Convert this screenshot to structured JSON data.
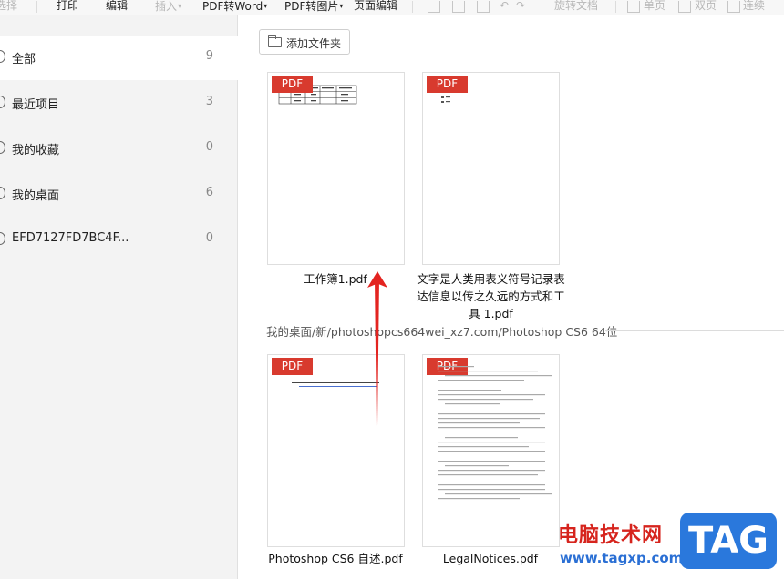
{
  "toolbar": {
    "first": "选择",
    "print": "打印",
    "edit": "编辑",
    "insert": "插入",
    "pdf_to_word": "PDF转Word",
    "pdf_to_image": "PDF转图片",
    "page_edit": "页面编辑",
    "rotate": "旋转文档",
    "single_page": "单页",
    "double_page": "双页",
    "continuous": "连续"
  },
  "sidebar": {
    "items": [
      {
        "label": "全部",
        "count": "9",
        "icon": "all-files-icon"
      },
      {
        "label": "最近项目",
        "count": "3",
        "icon": "clock-icon"
      },
      {
        "label": "我的收藏",
        "count": "0",
        "icon": "star-icon"
      },
      {
        "label": "我的桌面",
        "count": "6",
        "icon": "desktop-icon"
      },
      {
        "label": "EFD7127FD7BC4F...",
        "count": "0",
        "icon": "cloud-icon"
      }
    ]
  },
  "main": {
    "add_folder_label": "添加文件夹",
    "badge": "PDF",
    "files_top": [
      {
        "name": "工作簿1.pdf"
      },
      {
        "name": "文字是人类用表义符号记录表达信息以传之久远的方式和工具 1.pdf"
      }
    ],
    "path_label": "我的桌面/新/photoshopcs664wei_xz7.com/Photoshop CS6 64位",
    "files_bottom": [
      {
        "name": "Photoshop CS6 自述.pdf",
        "preview_title": "需要访问以下位置来获取 Photoshop CS6 自述"
      },
      {
        "name": "LegalNotices.pdf",
        "preview_title": "Third Party Legal Notices"
      }
    ]
  },
  "watermark": {
    "text": "电脑技术网",
    "url": "www.tagxp.com",
    "tag": "TAG"
  },
  "colors": {
    "pdf_badge": "#d83a2e",
    "arrow": "#e32420",
    "watermark_red": "#d6241d",
    "watermark_blue": "#2a78dc"
  }
}
